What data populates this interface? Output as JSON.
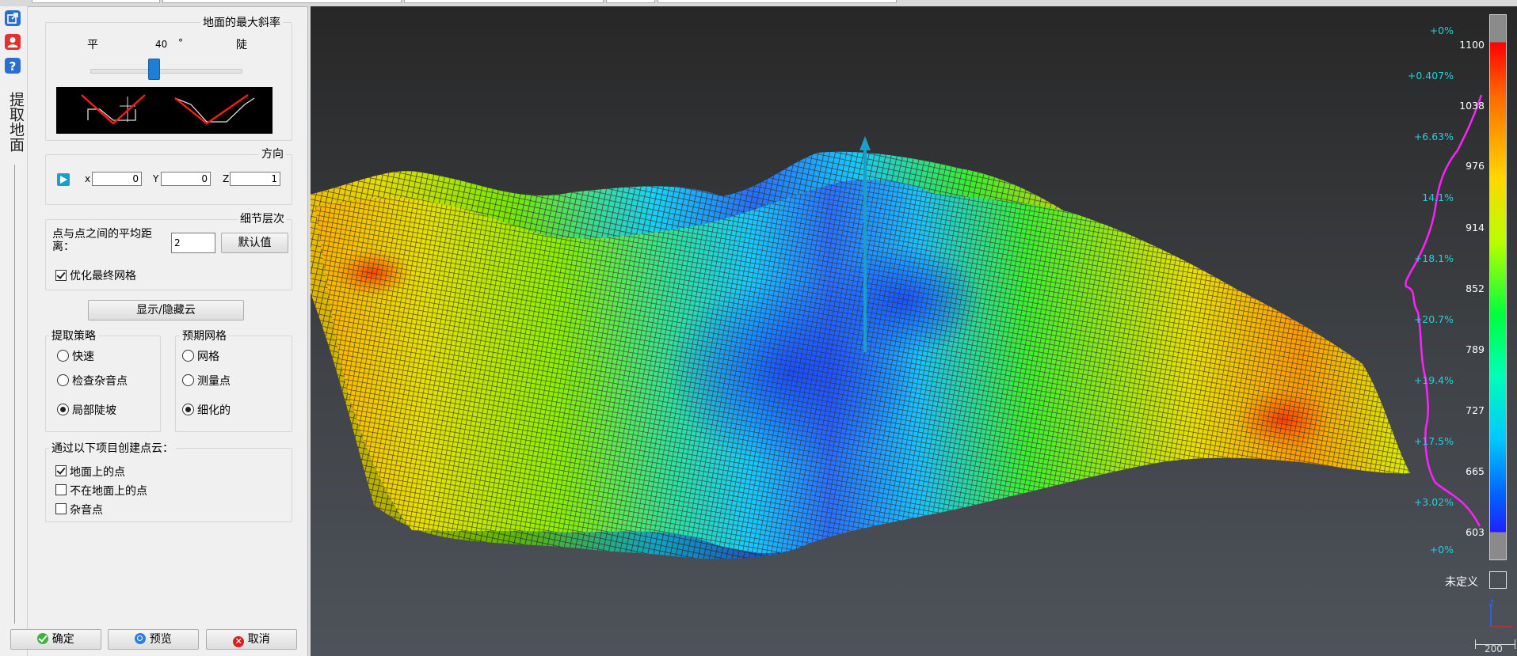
{
  "toolbar": {
    "vertical_title": "提取地面",
    "icons": [
      "export-icon",
      "user-icon",
      "help-icon"
    ]
  },
  "max_slope": {
    "legend": "地面的最大斜率",
    "flat_label": "平",
    "steep_label": "陡",
    "value": "40",
    "unit": "°",
    "slider_fraction": 0.44
  },
  "direction": {
    "legend": "方向",
    "x_label": "x",
    "y_label": "Y",
    "z_label": "Z",
    "x_value": "0",
    "y_value": "0",
    "z_value": "1"
  },
  "detail": {
    "legend": "细节层次",
    "distance_label": "点与点之间的平均距离：",
    "distance_value": "2",
    "default_button": "默认值",
    "optimize_label": "优化最终网格",
    "optimize_checked": true
  },
  "toggle_cloud_button": "显示/隐藏云",
  "strategy": {
    "legend": "提取策略",
    "options": [
      "快速",
      "检查杂音点",
      "局部陡坡"
    ],
    "selected": 2
  },
  "expected_mesh": {
    "legend": "预期网格",
    "options": [
      "网格",
      "测量点",
      "细化的"
    ],
    "selected": 2
  },
  "create_cloud": {
    "legend": "通过以下项目创建点云：",
    "items": [
      {
        "label": "地面上的点",
        "checked": true
      },
      {
        "label": "不在地面上的点",
        "checked": false
      },
      {
        "label": "杂音点",
        "checked": false
      }
    ]
  },
  "footer": {
    "ok": "确定",
    "preview": "预览",
    "cancel": "取消"
  },
  "color_scale": {
    "ticks": [
      "1100",
      "1038",
      "976",
      "914",
      "852",
      "789",
      "727",
      "665",
      "603"
    ],
    "percents": [
      "+0%",
      "+0.407%",
      "+6.63%",
      "14.1%",
      "+18.1%",
      "+20.7%",
      "+19.4%",
      "+17.5%",
      "+3.02%",
      "+0%"
    ],
    "undefined_label": "未定义"
  },
  "axis": {
    "z_label": "Z",
    "scale_label": "200"
  },
  "colors": {
    "histogram": "#ff22ff",
    "percent_text": "#22d0e0",
    "normal_arrow": "#1aa0c8"
  }
}
